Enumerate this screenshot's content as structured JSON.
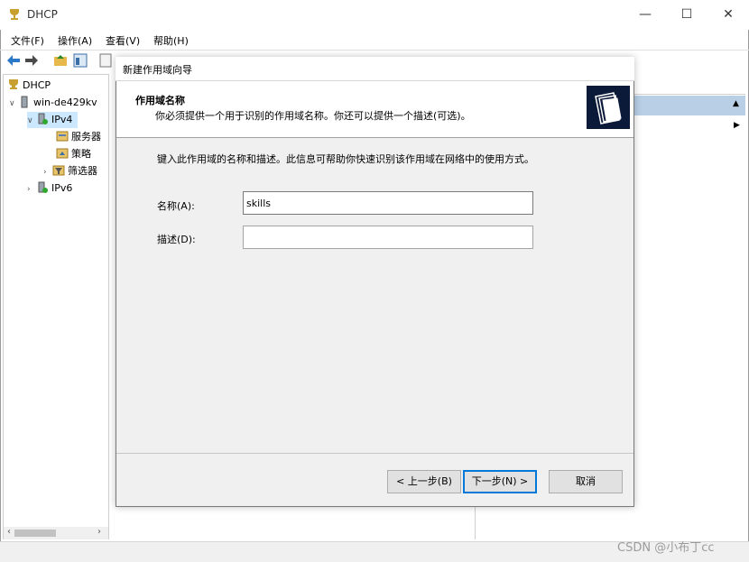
{
  "window": {
    "title": "DHCP",
    "minimize": "—",
    "maximize": "☐",
    "close": "✕"
  },
  "menu": {
    "file": "文件(F)",
    "action": "操作(A)",
    "view": "查看(V)",
    "help": "帮助(H)"
  },
  "tree": {
    "root": "DHCP",
    "server": "win-de429kv",
    "ipv4": "IPv4",
    "server_options": "服务器",
    "policies": "策略",
    "filters": "筛选器",
    "ipv6": "IPv6"
  },
  "dialog": {
    "title": "新建作用域向导",
    "heading": "作用域名称",
    "subheading": "你必须提供一个用于识别的作用域名称。你还可以提供一个描述(可选)。",
    "instruction": "键入此作用域的名称和描述。此信息可帮助你快速识别该作用域在网络中的使用方式。",
    "name_label": "名称(A):",
    "name_value": "skills",
    "desc_label": "描述(D):",
    "desc_value": "",
    "back_button": "< 上一步(B)",
    "next_button": "下一步(N) >",
    "cancel_button": "取消"
  },
  "watermark": "CSDN @小布丁cc",
  "colors": {
    "selection": "#cce8ff",
    "focus_border": "#0078d7",
    "wizard_icon_bg": "#0c1a3a"
  }
}
